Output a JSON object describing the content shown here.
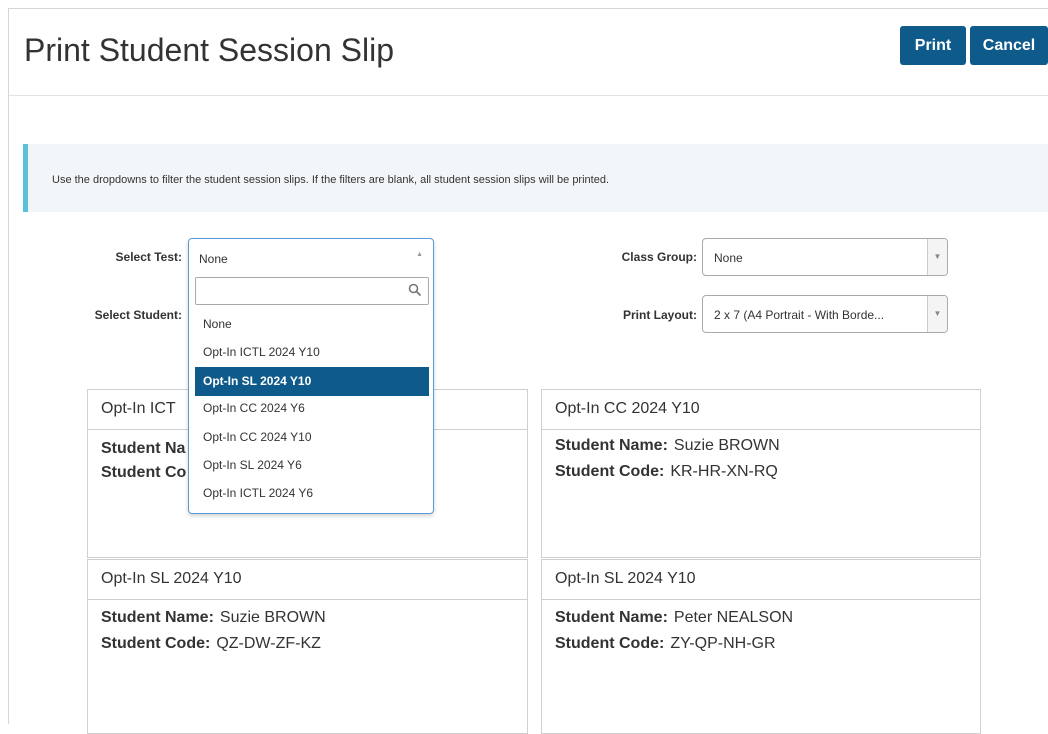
{
  "page": {
    "title": "Print Student Session Slip",
    "print_label": "Print",
    "cancel_label": "Cancel",
    "info": "Use the dropdowns to filter the student session slips. If the filters are blank, all student session slips will be printed."
  },
  "filters": {
    "select_test_label": "Select Test:",
    "select_test_value": "None",
    "select_student_label": "Select Student:",
    "class_group_label": "Class Group:",
    "class_group_value": "None",
    "print_layout_label": "Print Layout:",
    "print_layout_value": "2 x 7 (A4 Portrait - With Borde..."
  },
  "dropdown": {
    "current": "None",
    "search_value": "",
    "options": [
      {
        "label": "None"
      },
      {
        "label": "Opt-In ICTL 2024 Y10"
      },
      {
        "label": "Opt-In SL 2024 Y10"
      },
      {
        "label": "Opt-In CC 2024 Y6"
      },
      {
        "label": "Opt-In CC 2024 Y10"
      },
      {
        "label": "Opt-In SL 2024 Y6"
      },
      {
        "label": "Opt-In ICTL 2024 Y6"
      }
    ],
    "highlighted": "Opt-In SL 2024 Y10"
  },
  "slips": [
    {
      "test": "Opt-In ICT",
      "name_label": "Student Na",
      "code_label": "Student Co",
      "name": "",
      "code": ""
    },
    {
      "test": "Opt-In CC 2024 Y10",
      "name_label": "Student Name:",
      "code_label": "Student Code:",
      "name": "Suzie BROWN",
      "code": "KR-HR-XN-RQ"
    },
    {
      "test": "Opt-In SL 2024 Y10",
      "name_label": "Student Name:",
      "code_label": "Student Code:",
      "name": "Suzie BROWN",
      "code": "QZ-DW-ZF-KZ"
    },
    {
      "test": "Opt-In SL 2024 Y10",
      "name_label": "Student Name:",
      "code_label": "Student Code:",
      "name": "Peter NEALSON",
      "code": "ZY-QP-NH-GR"
    }
  ],
  "colors": {
    "primary": "#0e5a8a",
    "info_border": "#5bc0de",
    "info_bg": "#f2f6f9",
    "focus_border": "#5b9bd5"
  },
  "icons": {
    "search": "search-icon",
    "dropdown_up": "caret-up-icon",
    "dropdown_down": "caret-down-icon"
  }
}
